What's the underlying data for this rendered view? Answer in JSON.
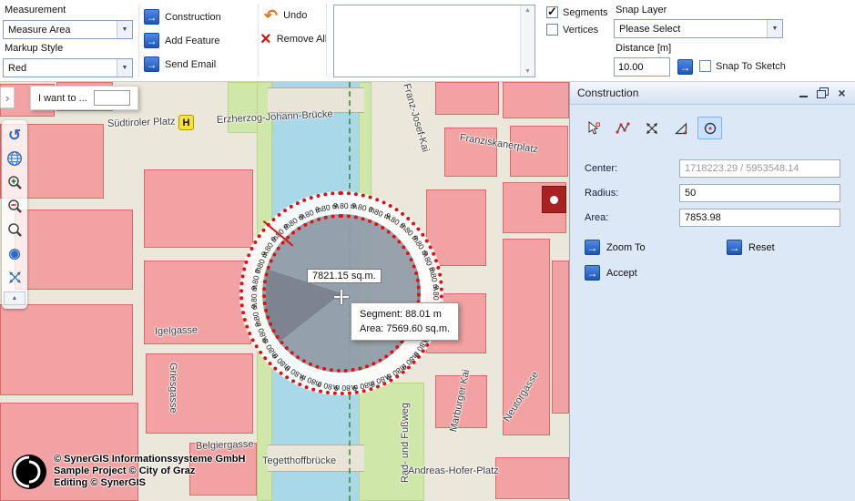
{
  "toolbar": {
    "measurement_label": "Measurement",
    "measurement_value": "Measure Area",
    "markup_style_label": "Markup Style",
    "markup_style_value": "Red",
    "construction_button": "Construction",
    "add_feature_button": "Add Feature",
    "send_email_button": "Send Email",
    "undo_button": "Undo",
    "remove_all_button": "Remove All",
    "segments_label": "Segments",
    "segments_checked": true,
    "vertices_label": "Vertices",
    "vertices_checked": false,
    "snap_layer_label": "Snap Layer",
    "snap_layer_value": "Please Select",
    "distance_label": "Distance [m]",
    "distance_value": "10.00",
    "snap_to_sketch_label": "Snap To Sketch",
    "snap_to_sketch_checked": false
  },
  "map": {
    "i_want_to_label": "I want to ...",
    "h_marker": "H",
    "street_labels": [
      "Südtiroler Platz",
      "Erzherzog-Johann-Brücke",
      "Franz-Josef-Kai",
      "Franziskanerplatz",
      "Igelgasse",
      "Griesgasse",
      "Belgiergasse",
      "Tegetthoffbrücke",
      "Rad- und Fußweg",
      "Marburger Kai",
      "Andreas-Hofer-Platz",
      "Neutorgasse"
    ],
    "measurement": {
      "area_label": "7821.15 sq.m.",
      "segment_label": "9.80 m",
      "segment_count": 32,
      "tooltip_segment": "Segment: 88.01 m",
      "tooltip_area": "Area: 7569.60 sq.m."
    },
    "copyright": [
      "© SynerGIS Informationssysteme GmbH",
      "Sample Project © City of Graz",
      "Editing © SynerGIS"
    ]
  },
  "panel": {
    "title": "Construction",
    "center_label": "Center:",
    "center_value": "1718223.29 / 5953548.14",
    "radius_label": "Radius:",
    "radius_value": "50",
    "area_label": "Area:",
    "area_value": "7853.98",
    "zoom_to_button": "Zoom To",
    "reset_button": "Reset",
    "accept_button": "Accept"
  },
  "colors": {
    "accent_blue": "#2563c4",
    "selection_red": "#e01010",
    "building_pink": "#f2a2a2",
    "river_blue": "#a9d8e9",
    "panel_bg": "#dce8f6"
  }
}
